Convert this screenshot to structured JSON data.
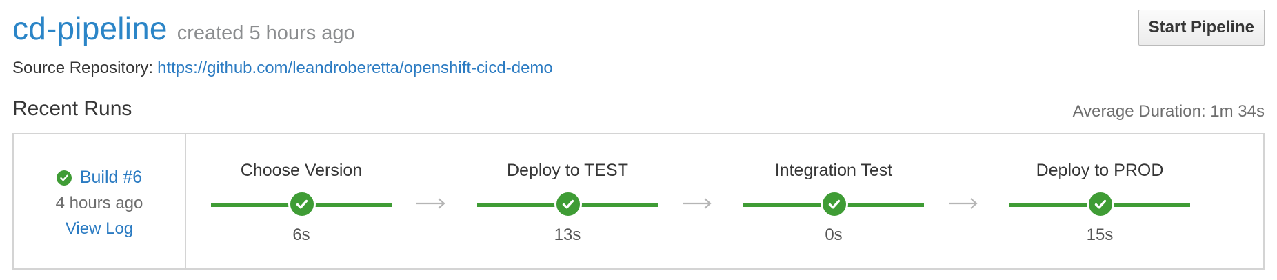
{
  "pipeline": {
    "name": "cd-pipeline",
    "created": "created 5 hours ago",
    "start_button": "Start Pipeline",
    "source_label": "Source Repository:",
    "source_url": "https://github.com/leandroberetta/openshift-cicd-demo"
  },
  "recent_runs": {
    "title": "Recent Runs",
    "average_duration": "Average Duration: 1m 34s"
  },
  "build": {
    "status": "success",
    "label": "Build #6",
    "time": "4 hours ago",
    "view_log": "View Log"
  },
  "stages": [
    {
      "name": "Choose Version",
      "duration": "6s",
      "status": "success"
    },
    {
      "name": "Deploy to TEST",
      "duration": "13s",
      "status": "success"
    },
    {
      "name": "Integration Test",
      "duration": "0s",
      "status": "success"
    },
    {
      "name": "Deploy to PROD",
      "duration": "15s",
      "status": "success"
    }
  ],
  "colors": {
    "success": "#3f9c35",
    "link": "#2b7bc2",
    "title": "#2b85c7"
  },
  "icons": {
    "status": "check-circle-icon",
    "connector": "arrow-right-icon"
  }
}
